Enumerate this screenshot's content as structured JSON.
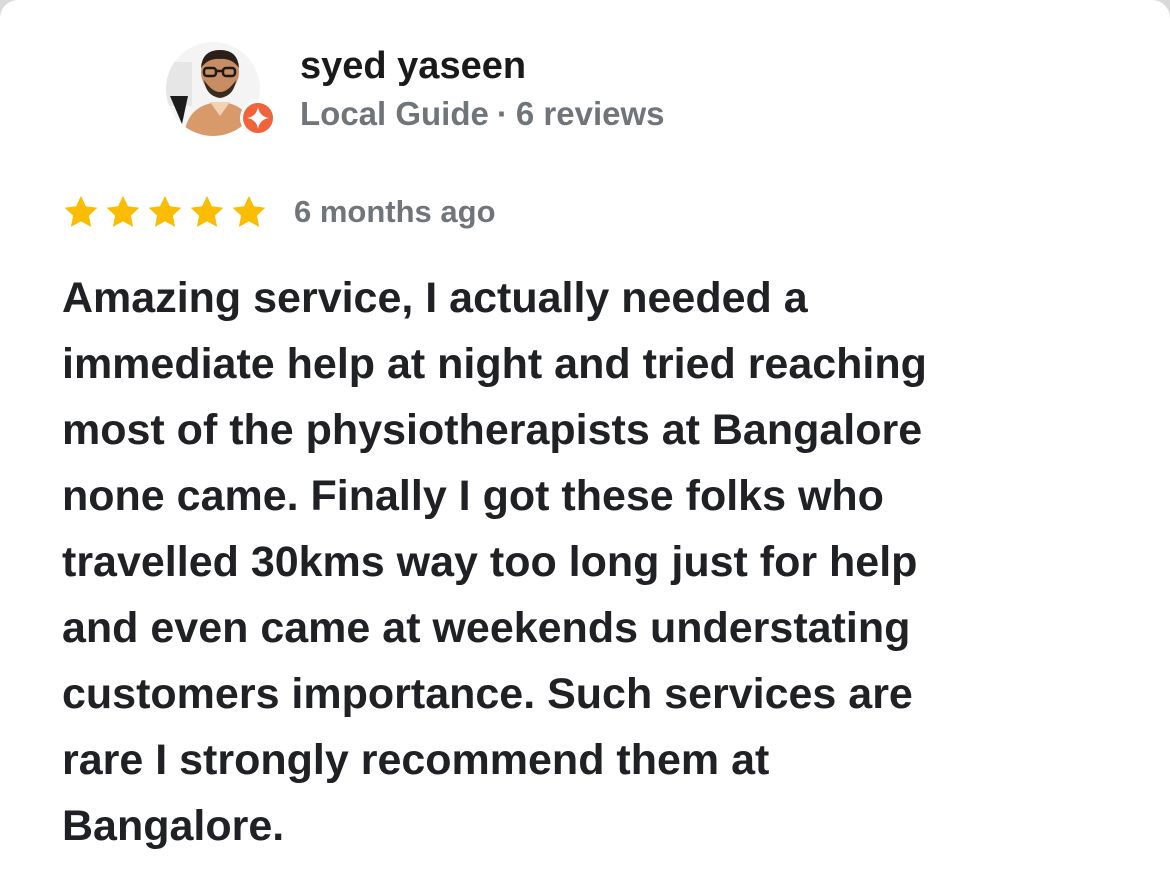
{
  "reviewer": {
    "name": "syed yaseen",
    "badge": "Local Guide",
    "separator": "·",
    "review_count": "6 reviews",
    "avatar_icon": "profile-photo",
    "badge_icon": "local-guide-star-icon"
  },
  "review": {
    "rating": 5,
    "max_rating": 5,
    "date": "6 months ago",
    "text": "Amazing service, I actually needed a\nimmediate help at night and tried reaching\nmost of the physiotherapists at Bangalore\nnone came. Finally I got these folks who\ntravelled 30kms way too long just for help\nand even came at weekends understating\ncustomers importance. Such services are\nrare I strongly recommend them at\nBangalore."
  },
  "colors": {
    "star": "#fbbc04",
    "badge": "#f1633a",
    "text": "#202124",
    "secondary": "#70757a"
  }
}
